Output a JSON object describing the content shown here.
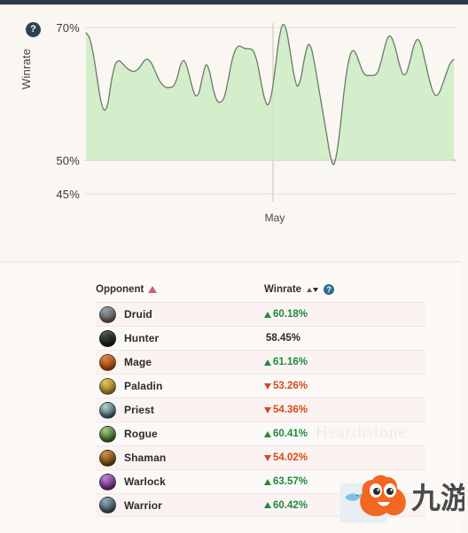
{
  "header": {
    "help_icon": "question-circle-icon"
  },
  "chart": {
    "y_axis_title": "Winrate",
    "y_ticks": [
      "70%",
      "50%",
      "45%"
    ],
    "x_ticks": [
      "May"
    ],
    "line_color": "#6b7b68",
    "area_color": "#cdebc4",
    "grid_color": "#e3dbd4"
  },
  "chart_data": {
    "type": "area",
    "title": "",
    "xlabel": "",
    "ylabel": "Winrate",
    "ylim": [
      45,
      72
    ],
    "grid": true,
    "legend": "none",
    "axis_tick_labels_y": [
      "70%",
      "50%",
      "45%"
    ],
    "axis_tick_labels_x": [
      "May"
    ],
    "x_marker_label": "May",
    "series": [
      {
        "name": "Winrate",
        "values": [
          69.2,
          68.4,
          66.0,
          62.6,
          59.2,
          57.6,
          58.6,
          62.0,
          64.4,
          65.0,
          64.6,
          64.0,
          63.6,
          63.4,
          63.6,
          64.2,
          65.0,
          65.2,
          64.6,
          63.4,
          62.2,
          61.4,
          61.0,
          61.0,
          61.2,
          62.4,
          64.4,
          65.0,
          63.6,
          61.4,
          59.8,
          60.2,
          62.6,
          64.4,
          63.2,
          60.6,
          59.0,
          58.8,
          59.6,
          62.0,
          64.8,
          66.6,
          67.2,
          67.0,
          66.8,
          66.8,
          66.4,
          64.8,
          62.0,
          59.4,
          58.4,
          60.2,
          64.0,
          68.2,
          70.4,
          69.6,
          66.6,
          63.2,
          61.2,
          62.4,
          65.4,
          67.4,
          66.6,
          63.8,
          60.6,
          57.4,
          54.2,
          51.0,
          49.4,
          51.6,
          56.0,
          61.0,
          64.6,
          66.4,
          66.2,
          64.8,
          63.4,
          62.8,
          62.8,
          62.8,
          63.2,
          64.8,
          67.0,
          68.6,
          68.4,
          66.8,
          64.6,
          63.0,
          63.2,
          65.0,
          67.2,
          68.2,
          67.4,
          65.2,
          62.8,
          60.8,
          59.8,
          60.2,
          61.6,
          63.2,
          64.6,
          65.2
        ]
      }
    ]
  },
  "table": {
    "columns": [
      {
        "key": "opponent",
        "label": "Opponent",
        "sort": "asc",
        "sort_icon": "sort-ascending-icon"
      },
      {
        "key": "winrate",
        "label": "Winrate",
        "sort": "desc",
        "sort_icon": "sort-both-icon",
        "help_icon": "question-circle-icon"
      }
    ],
    "rows": [
      {
        "name": "Druid",
        "winrate": "60.18%",
        "trend": "up",
        "icon_color_a": "#8d9db0",
        "icon_color_b": "#5a4a3f"
      },
      {
        "name": "Hunter",
        "winrate": "58.45%",
        "trend": "flat",
        "icon_color_a": "#3c4a33",
        "icon_color_b": "#11150e"
      },
      {
        "name": "Mage",
        "winrate": "61.16%",
        "trend": "up",
        "icon_color_a": "#e07a2c",
        "icon_color_b": "#8c3d12"
      },
      {
        "name": "Paladin",
        "winrate": "53.26%",
        "trend": "down",
        "icon_color_a": "#e0c257",
        "icon_color_b": "#8a6a1c"
      },
      {
        "name": "Priest",
        "winrate": "54.36%",
        "trend": "down",
        "icon_color_a": "#a9d6d2",
        "icon_color_b": "#2d4a4e"
      },
      {
        "name": "Rogue",
        "winrate": "60.41%",
        "trend": "up",
        "icon_color_a": "#9dc87a",
        "icon_color_b": "#33501f"
      },
      {
        "name": "Shaman",
        "winrate": "54.02%",
        "trend": "down",
        "icon_color_a": "#c98c3a",
        "icon_color_b": "#5a3410"
      },
      {
        "name": "Warlock",
        "winrate": "63.57%",
        "trend": "up",
        "icon_color_a": "#c07ad0",
        "icon_color_b": "#54206a"
      },
      {
        "name": "Warrior",
        "winrate": "60.42%",
        "trend": "up",
        "icon_color_a": "#90a8b8",
        "icon_color_b": "#2e3c49"
      }
    ]
  },
  "watermark": {
    "text": "九游",
    "brand_text": "九游",
    "mascot_color": "#f26722"
  }
}
